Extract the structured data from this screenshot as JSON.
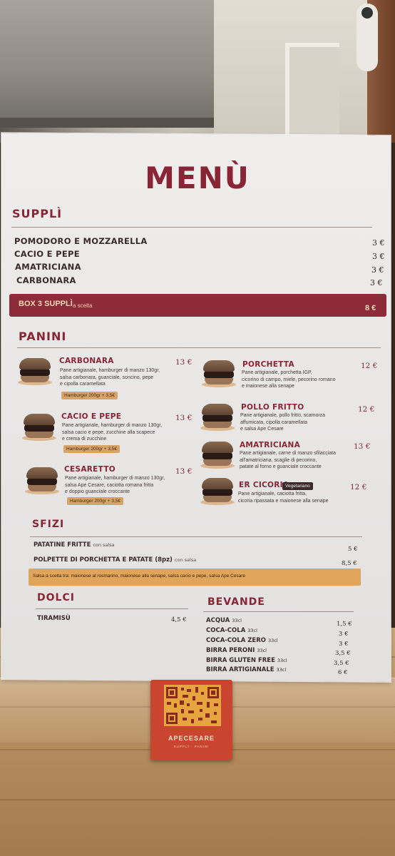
{
  "menu": {
    "title": "MENÙ",
    "suppli": {
      "heading": "SUPPLÌ",
      "items": [
        {
          "name": "POMODORO E MOZZARELLA",
          "price": "3 €"
        },
        {
          "name": "CACIO E PEPE",
          "price": "3 €"
        },
        {
          "name": "AMATRICIANA",
          "price": "3 €"
        },
        {
          "name": "CARBONARA",
          "price": "3 €"
        }
      ],
      "box": {
        "name": "BOX 3 SUPPLÌ",
        "note": "a scelta",
        "price": "8 €"
      }
    },
    "panini": {
      "heading": "PANINI",
      "left": [
        {
          "name": "CARBONARA",
          "price": "13 €",
          "desc": [
            "Pane artigianale, hamburger di manzo 130gr,",
            "salsa carbonara, guanciale, soncino, pepe",
            "e cipolla caramellata"
          ],
          "tag": "Hamburger 200gr + 3,5€"
        },
        {
          "name": "CACIO E PEPE",
          "price": "13 €",
          "desc": [
            "Pane artigianale, hamburger di manzo 130gr,",
            "salsa cacio e pepe, zucchine alla scapece",
            "e crema di zucchine"
          ],
          "tag": "Hamburger 200gr + 3,5€"
        },
        {
          "name": "CESARETTO",
          "price": "13 €",
          "desc": [
            "Pane artigianale, hamburger di manzo 130gr,",
            "salsa Ape Cesare, caciotta romana fritta",
            "e doppio guanciale croccante"
          ],
          "tag": "Hamburger 200gr + 3,5€"
        }
      ],
      "right": [
        {
          "name": "PORCHETTA",
          "price": "12 €",
          "desc": [
            "Pane artigianale, porchetta IGP,",
            "cicorino di campo, miele, pecorino romano",
            "e maionese alla senape"
          ]
        },
        {
          "name": "POLLO FRITTO",
          "price": "12 €",
          "desc": [
            "Pane artigianale, pollo fritto, scamorza",
            "affumicata, cipolla caramellata",
            "e salsa Ape Cesare"
          ]
        },
        {
          "name": "AMATRICIANA",
          "price": "13 €",
          "desc": [
            "Pane artigianale, carne di manzo sfilacciata",
            "all'amatriciana, scaglie di pecorino,",
            "patate al forno e guanciale croccante"
          ]
        },
        {
          "name": "ER CICORIA",
          "badge": "Vegetariano",
          "price": "12 €",
          "desc": [
            "Pane artigianale, caciotta fritta,",
            "cicoria ripassata e maionese alla senape"
          ]
        }
      ]
    },
    "sfizi": {
      "heading": "SFIZI",
      "items": [
        {
          "name": "PATATINE FRITTE",
          "note": "con salsa",
          "price": "5 €"
        },
        {
          "name": "POLPETTE DI PORCHETTA E PATATE (8pz)",
          "note": "con salsa",
          "price": "8,5 €"
        }
      ],
      "sauces": "Salsa a scelta tra: maionese al rosmarino, maionese alla senape, salsa cacio e pepe, salsa Ape Cesare"
    },
    "dolci": {
      "heading": "DOLCI",
      "items": [
        {
          "name": "TIRAMISÙ",
          "price": "4,5 €"
        }
      ]
    },
    "bevande": {
      "heading": "BEVANDE",
      "items": [
        {
          "name": "ACQUA",
          "unit": "33cl",
          "price": "1,5 €"
        },
        {
          "name": "COCA-COLA",
          "unit": "33cl",
          "price": "3 €"
        },
        {
          "name": "COCA-COLA ZERO",
          "unit": "33cl",
          "price": "3 €"
        },
        {
          "name": "BIRRA PERONI",
          "unit": "33cl",
          "price": "3,5 €"
        },
        {
          "name": "BIRRA GLUTEN FREE",
          "unit": "33cl",
          "price": "3,5 €"
        },
        {
          "name": "BIRRA ARTIGIANALE",
          "unit": "33cl",
          "price": "6 €"
        }
      ]
    }
  },
  "qr_card": {
    "brand": "APECESARE",
    "tagline": "SUPPLÌ · PANINI"
  },
  "colors": {
    "brand_red": "#8a2536",
    "accent_orange": "#e0a45a",
    "card_red": "#c9452f"
  }
}
